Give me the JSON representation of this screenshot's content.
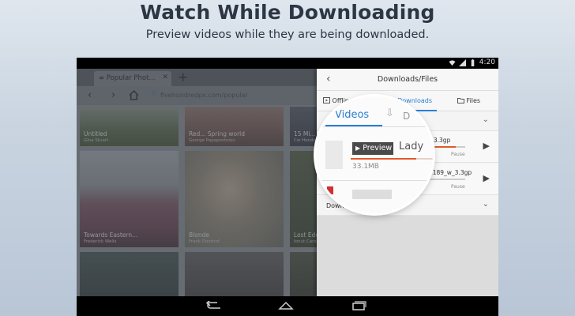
{
  "hero": {
    "title": "Watch While Downloading",
    "subtitle": "Preview videos while they are being downloaded."
  },
  "status_bar": {
    "time": "4:20",
    "icons": [
      "wifi-icon",
      "signal-icon",
      "battery-icon"
    ]
  },
  "browser": {
    "tab_title": "Popular Phot...",
    "url": "fivehundredpx.com/popular",
    "thumbnails": [
      {
        "title": "Untitled",
        "author": "Gina Stuart"
      },
      {
        "title": "Red... Spring world",
        "author": "George Papapostolou"
      },
      {
        "title": "15 Mi...",
        "author": "Cw Henderson"
      },
      {
        "title": "Towards Eastern...",
        "author": "Frederick Wells"
      },
      {
        "title": "Blonde",
        "author": "Frank Doorhof"
      },
      {
        "title": "Lost Eden",
        "author": "Ionut Caras"
      }
    ]
  },
  "downloads": {
    "title": "Downloads/Files",
    "tabs": [
      {
        "label": "OfflineVideos",
        "icon": "video-file-icon"
      },
      {
        "label": "Downloads",
        "icon": "download-icon",
        "active": true
      },
      {
        "label": "Files",
        "icon": "folder-icon"
      }
    ],
    "section_in_progress": "D",
    "items": [
      {
        "filename": "w_3.3gp",
        "state": "Pause",
        "progress": 0.85
      },
      {
        "filename": "ce189_w_3.3gp",
        "state": "Pause",
        "progress": 0.4
      }
    ],
    "section_complete": "Download complete (0)"
  },
  "magnifier": {
    "tab_label": "Videos",
    "tab_partial": "D",
    "preview_label": "Preview",
    "title_partial": "Lady",
    "size": "33.1MB",
    "progress": 0.8
  },
  "colors": {
    "accent": "#2a7fd4",
    "progress": "#e05a2a"
  }
}
